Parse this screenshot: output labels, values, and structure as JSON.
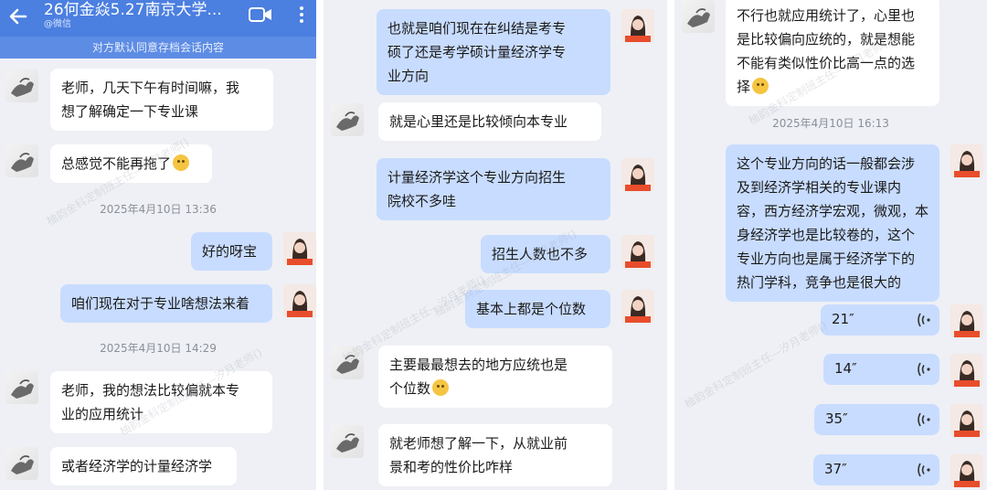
{
  "header": {
    "title": "26何金焱5.27南京大学...",
    "subtitle": "@微信",
    "notice": "对方默认同意存档会话内容",
    "back_icon": "back-arrow-icon",
    "video_icon": "video-call-icon",
    "more_icon": "more-vertical-icon"
  },
  "panel1": {
    "m1": "老师，几天下午有时间嘛，我\n想了解确定一下专业课",
    "m2": "总感觉不能再拖了",
    "ts1": "2025年4月10日  13:36",
    "m3": "好的呀宝",
    "m4": "咱们现在对于专业啥想法来着",
    "ts2": "2025年4月10日  14:29",
    "m5": "老师，我的想法比较偏就本专\n业的应用统计",
    "m6": "或者经济学的计量经济学"
  },
  "panel2": {
    "m1": "也就是咱们现在在纠结是考专\n硕了还是考学硕计量经济学专\n业方向",
    "m2": "就是心里还是比较倾向本专业",
    "m3": "计量经济学这个专业方向招生\n院校不多哇",
    "m4": "招生人数也不多",
    "m5": "基本上都是个位数",
    "m6": "主要最最想去的地方应统也是\n个位数",
    "m7": "就老师想了解一下，从就业前\n景和考的性价比咋样"
  },
  "panel3": {
    "m1": "不行也就应用统计了，心里也\n是比较偏向应统的，就是想能\n不能有类似性价比高一点的选\n择",
    "ts1": "2025年4月10日  16:13",
    "m2": "这个专业方向的话一般都会涉\n及到经济学相关的专业课内\n容，西方经济学宏观，微观，本\n身经济学也是比较卷的，这个\n专业方向也是属于经济学下的\n热门学科，竞争也是很大的",
    "voices": [
      "21″",
      "14″",
      "35″",
      "37″"
    ]
  },
  "watermark": "柚韵金科定制班主任—汐月老师()",
  "colors": {
    "header": "#4b7fe0",
    "out_bubble": "#c8dcff",
    "in_bubble": "#ffffff",
    "bg": "#eef0f5"
  }
}
